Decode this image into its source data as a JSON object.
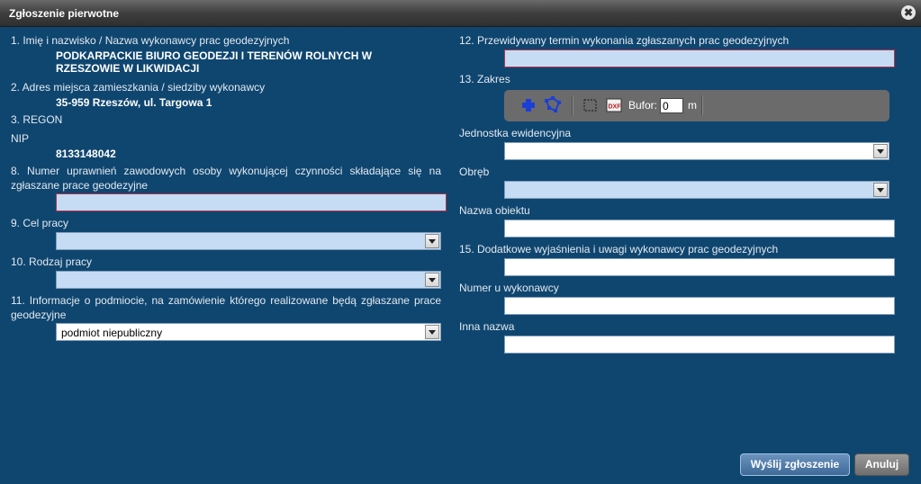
{
  "window": {
    "title": "Zgłoszenie pierwotne",
    "close_glyph": "✖"
  },
  "left": {
    "f1_label": "1. Imię i nazwisko / Nazwa wykonawcy prac geodezyjnych",
    "f1_value": "PODKARPACKIE BIURO GEODEZJI I TERENÓW ROLNYCH W RZESZOWIE W LIKWIDACJI",
    "f2_label": "2. Adres miejsca zamieszkania / siedziby wykonawcy",
    "f2_value": "35-959 Rzeszów, ul. Targowa 1",
    "f3_label": "3. REGON",
    "nip_label": "NIP",
    "nip_value": "8133148042",
    "f8_label": "8. Numer uprawnień zawodowych osoby wykonującej czynności składające się na zgłaszane prace geodezyjne",
    "f8_value": "",
    "f9_label": "9. Cel pracy",
    "f9_value": "",
    "f10_label": "10. Rodzaj pracy",
    "f10_value": "",
    "f11_label": "11. Informacje o podmiocie, na zamówienie którego realizowane będą zgłaszane prace geodezyjne",
    "f11_value": "podmiot niepubliczny"
  },
  "right": {
    "f12_label": "12. Przewidywany termin wykonania zgłaszanych prac geodezyjnych",
    "f12_value": "",
    "f13_label": "13. Zakres",
    "toolbar": {
      "buffer_label": "Bufor:",
      "buffer_value": "0",
      "buffer_unit": "m",
      "icons": [
        "add-point-icon",
        "draw-polygon-icon",
        "select-rectangle-icon",
        "dxf-import-icon"
      ]
    },
    "unit_label": "Jednostka ewidencyjna",
    "unit_value": "",
    "precinct_label": "Obręb",
    "precinct_value": "",
    "object_label": "Nazwa obiektu",
    "object_value": "",
    "f15_label": "15. Dodatkowe wyjaśnienia i uwagi wykonawcy prac geodezyjnych",
    "f15_value": "",
    "contractor_no_label": "Numer u wykonawcy",
    "contractor_no_value": "",
    "other_name_label": "Inna nazwa",
    "other_name_value": ""
  },
  "footer": {
    "submit_label": "Wyślij zgłoszenie",
    "cancel_label": "Anuluj"
  },
  "colors": {
    "background": "#0f4670",
    "required_field": "#c6dcf5",
    "required_border": "#b8334a"
  }
}
